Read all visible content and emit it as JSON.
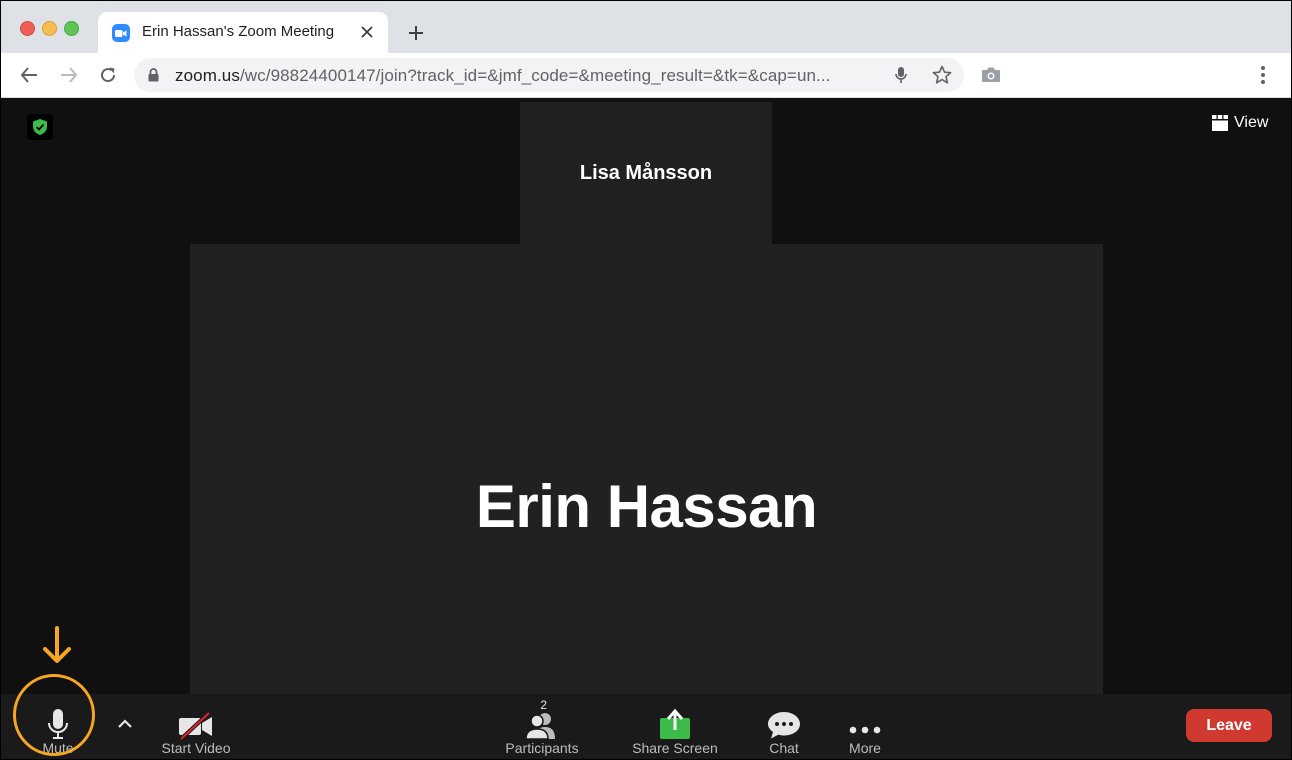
{
  "browser": {
    "tab_title": "Erin Hassan's Zoom Meeting",
    "url_host": "zoom.us",
    "url_path": "/wc/98824400147/join?track_id=&jmf_code=&meeting_result=&tk=&cap=un..."
  },
  "meeting": {
    "view_label": "View",
    "thumbnail_name": "Lisa Månsson",
    "speaker_name": "Erin Hassan"
  },
  "controls": {
    "mute": "Mute",
    "start_video": "Start Video",
    "participants": "Participants",
    "participants_count": "2",
    "share_screen": "Share Screen",
    "chat": "Chat",
    "more": "More",
    "leave": "Leave"
  },
  "colors": {
    "leave": "#d0392f",
    "share": "#3dbb48",
    "annotation": "#f5a623",
    "shield": "#3dbb48"
  }
}
